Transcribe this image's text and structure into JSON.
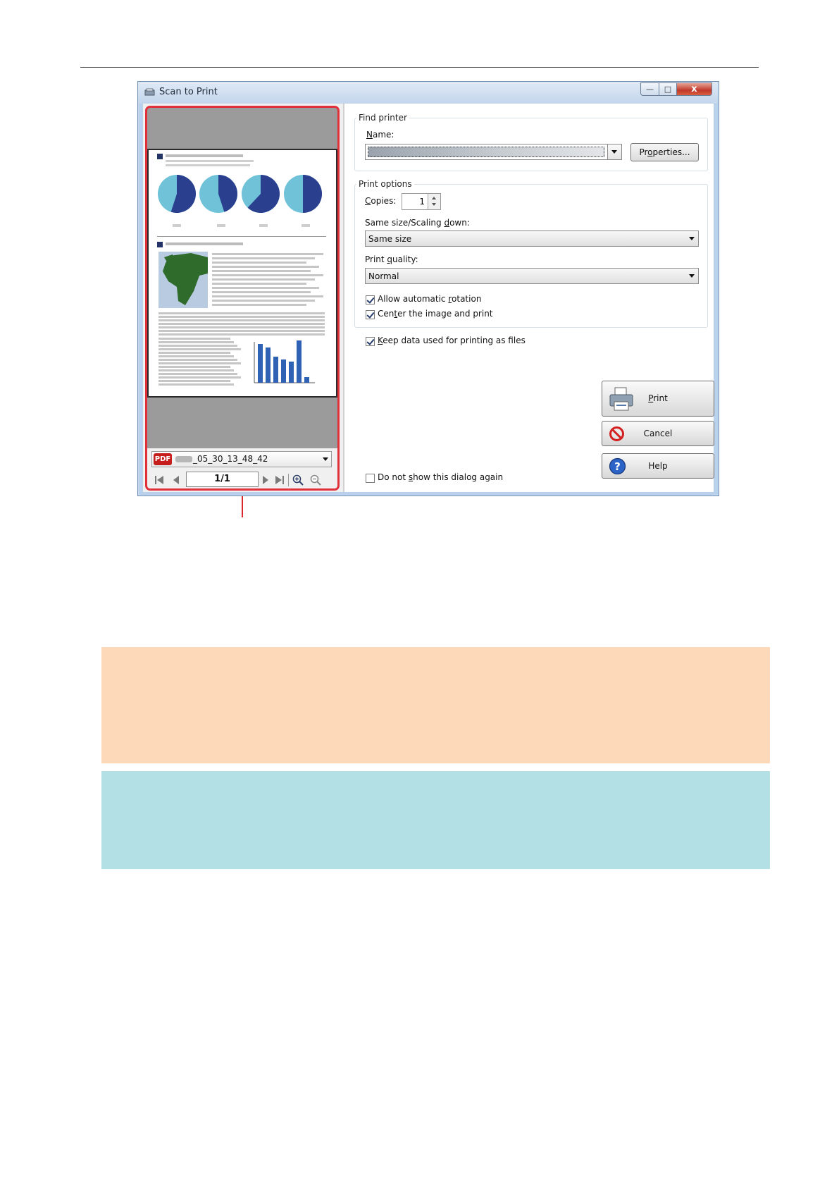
{
  "window": {
    "title": "Scan to Print",
    "close_glyph": "x"
  },
  "preview": {
    "file_badge": "PDF",
    "file_name": "_05_30_13_48_42",
    "page_indicator": "1/1",
    "pie_colors": [
      "#2b3f8f",
      "#6fc2d8"
    ],
    "bar_values": [
      0.55,
      0.5,
      0.37,
      0.33,
      0.3,
      0.6,
      0.08
    ]
  },
  "find_printer": {
    "group_label": "Find printer",
    "name_label": "Name:",
    "name_label_underline": "N",
    "name_label_rest": "ame:",
    "properties_pre": "Pr",
    "properties_ul": "o",
    "properties_post": "perties..."
  },
  "print_options": {
    "group_label": "Print options",
    "copies_ul": "C",
    "copies_rest": "opies:",
    "copies_value": "1",
    "scaling_pre": "Same size/Scaling ",
    "scaling_ul": "d",
    "scaling_post": "own:",
    "scaling_value": "Same size",
    "quality_pre": "Print ",
    "quality_ul": "q",
    "quality_post": "uality:",
    "quality_value": "Normal",
    "rotation_pre": "Allow automatic ",
    "rotation_ul": "r",
    "rotation_post": "otation",
    "rotation_checked": true,
    "center_pre": "Cen",
    "center_ul": "t",
    "center_post": "er the image and print",
    "center_checked": true
  },
  "keep_data": {
    "ul": "K",
    "rest": "eep data used for printing as files",
    "checked": true
  },
  "dont_show": {
    "pre": "Do not ",
    "ul": "s",
    "post": "how this dialog again",
    "checked": false
  },
  "buttons": {
    "print_ul": "P",
    "print_rest": "rint",
    "cancel": "Cancel",
    "help": "Help"
  },
  "colors": {
    "highlight_frame": "#e0303c",
    "hint_box": "#fdd9b9",
    "note_box": "#b2e0e4"
  }
}
